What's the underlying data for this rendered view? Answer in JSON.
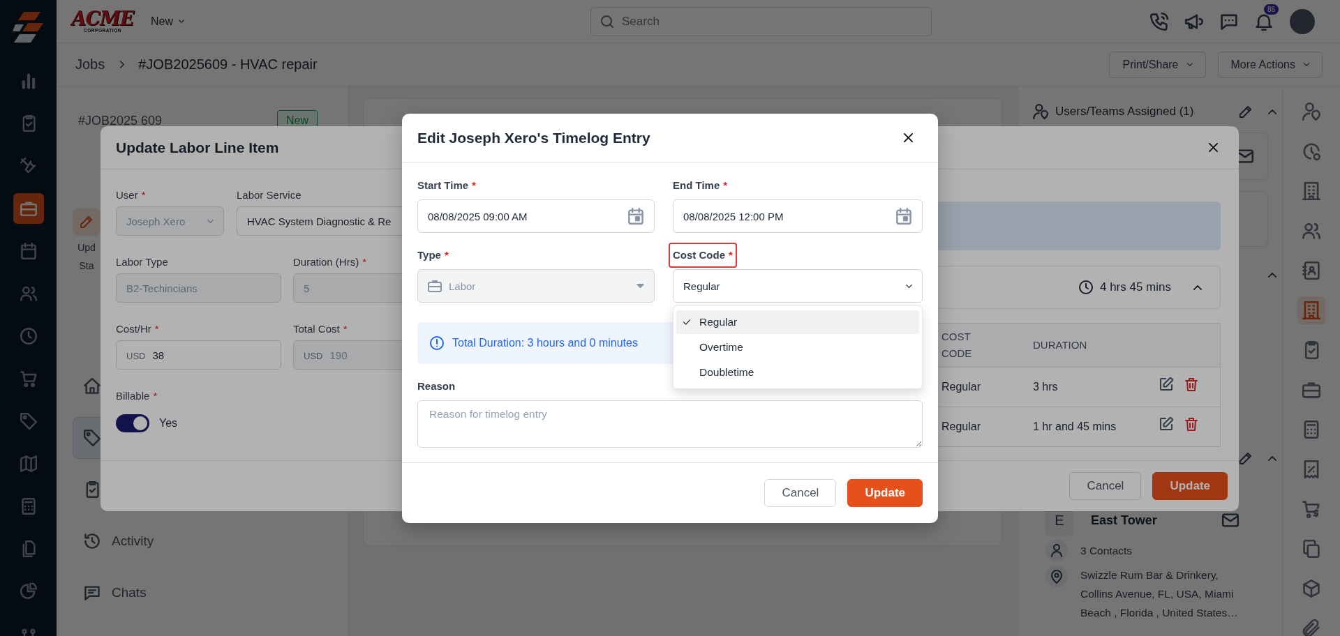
{
  "sidebar": {
    "items": [
      {
        "selected": false
      },
      {
        "selected": false
      },
      {
        "selected": false
      },
      {
        "selected": true
      },
      {
        "selected": false
      },
      {
        "selected": false
      },
      {
        "selected": false
      },
      {
        "selected": false
      },
      {
        "selected": false
      },
      {
        "selected": false
      },
      {
        "selected": false
      },
      {
        "selected": false
      },
      {
        "selected": false
      },
      {
        "selected": false
      }
    ]
  },
  "top_bar": {
    "logo": {
      "word": "ACME",
      "tagline": "CORPORATION"
    },
    "new_menu": "New",
    "search": {
      "placeholder": "Search"
    },
    "notifications": "86"
  },
  "header": {
    "breadcrumb": [
      "Jobs",
      "#JOB2025609 - HVAC repair"
    ],
    "actions": [
      "Print/Share",
      "More Actions"
    ]
  },
  "job_panel": {
    "job_number": "#JOB2025 609",
    "status": "New",
    "action": [
      "Upd",
      "Sta"
    ],
    "nav": [
      {
        "selected": false
      },
      {
        "selected": true
      },
      {
        "selected": false
      },
      {
        "label": "Activity",
        "selected": false
      },
      {
        "label": "Chats",
        "selected": false
      }
    ]
  },
  "details_panel": {
    "assigned": {
      "title": "Users/Teams Assigned (1)"
    },
    "location": {
      "initial": "E",
      "name": "East Tower",
      "contacts": "3 Contacts",
      "address": "Swizzle Rum Bar & Drinkery, Collins Avenue, FL, USA, Miami Beach , Florida , United States…"
    }
  },
  "side_rail": {
    "items": [
      {
        "selected": false
      },
      {
        "selected": false
      },
      {
        "selected": false
      },
      {
        "selected": false
      },
      {
        "selected": false
      },
      {
        "selected": true
      },
      {
        "selected": false
      },
      {
        "selected": false
      },
      {
        "selected": false
      },
      {
        "selected": false
      },
      {
        "selected": false
      },
      {
        "selected": false
      },
      {
        "selected": false
      },
      {
        "selected": false
      }
    ]
  },
  "labor_modal": {
    "title": "Update Labor Line Item",
    "fields": [
      {
        "label": "User",
        "mark": "*",
        "value": "Joseph Xero",
        "kind": "select",
        "disabled": true
      },
      {
        "label": "Labor Service",
        "value": "HVAC System Diagnostic & Re",
        "kind": "text",
        "disabled": false
      },
      {
        "label": "Labor Type",
        "value": "B2-Techincians",
        "kind": "text",
        "disabled": true
      },
      {
        "label": "Duration (Hrs)",
        "mark": "*",
        "value": "5",
        "kind": "text",
        "disabled": true
      },
      {
        "label": "Cost/Hr",
        "mark": "*",
        "prefix": "USD",
        "value": "38",
        "kind": "money",
        "disabled": false
      },
      {
        "label": "Total Cost",
        "mark": "*",
        "prefix": "USD",
        "value": "190",
        "kind": "money",
        "disabled": true
      }
    ],
    "billable": {
      "label": "Billable",
      "mark": "*",
      "on": true,
      "text": "Yes"
    },
    "total": "4 hrs 45 mins",
    "table": {
      "columns": [
        "COST CODE",
        "DURATION"
      ],
      "rows": [
        [
          "Regular",
          "3 hrs"
        ],
        [
          "Regular",
          "1 hr and 45 mins"
        ]
      ]
    },
    "buttons": [
      {
        "label": "Cancel",
        "kind": "secondary"
      },
      {
        "label": "Update",
        "kind": "primary"
      }
    ]
  },
  "timelog_modal": {
    "title": "Edit Joseph Xero's Timelog Entry",
    "start": {
      "label": "Start Time",
      "mark": "*",
      "value": "08/08/2025 09:00 AM"
    },
    "end": {
      "label": "End Time",
      "mark": "*",
      "value": "08/08/2025 12:00 PM"
    },
    "type": {
      "label": "Type",
      "mark": "*",
      "value": "Labor",
      "disabled": true
    },
    "cost_code": {
      "label": "Cost Code",
      "mark": "*",
      "highlighted": true,
      "value": "Regular",
      "expanded": true,
      "options": [
        {
          "label": "Regular",
          "selected": true
        },
        {
          "label": "Overtime",
          "selected": false
        },
        {
          "label": "Doubletime",
          "selected": false
        }
      ]
    },
    "info": "Total Duration: 3 hours and 0 minutes",
    "reason": {
      "label": "Reason",
      "placeholder": "Reason for timelog entry"
    },
    "buttons": [
      {
        "label": "Cancel",
        "kind": "secondary"
      },
      {
        "label": "Update",
        "kind": "primary"
      }
    ]
  }
}
